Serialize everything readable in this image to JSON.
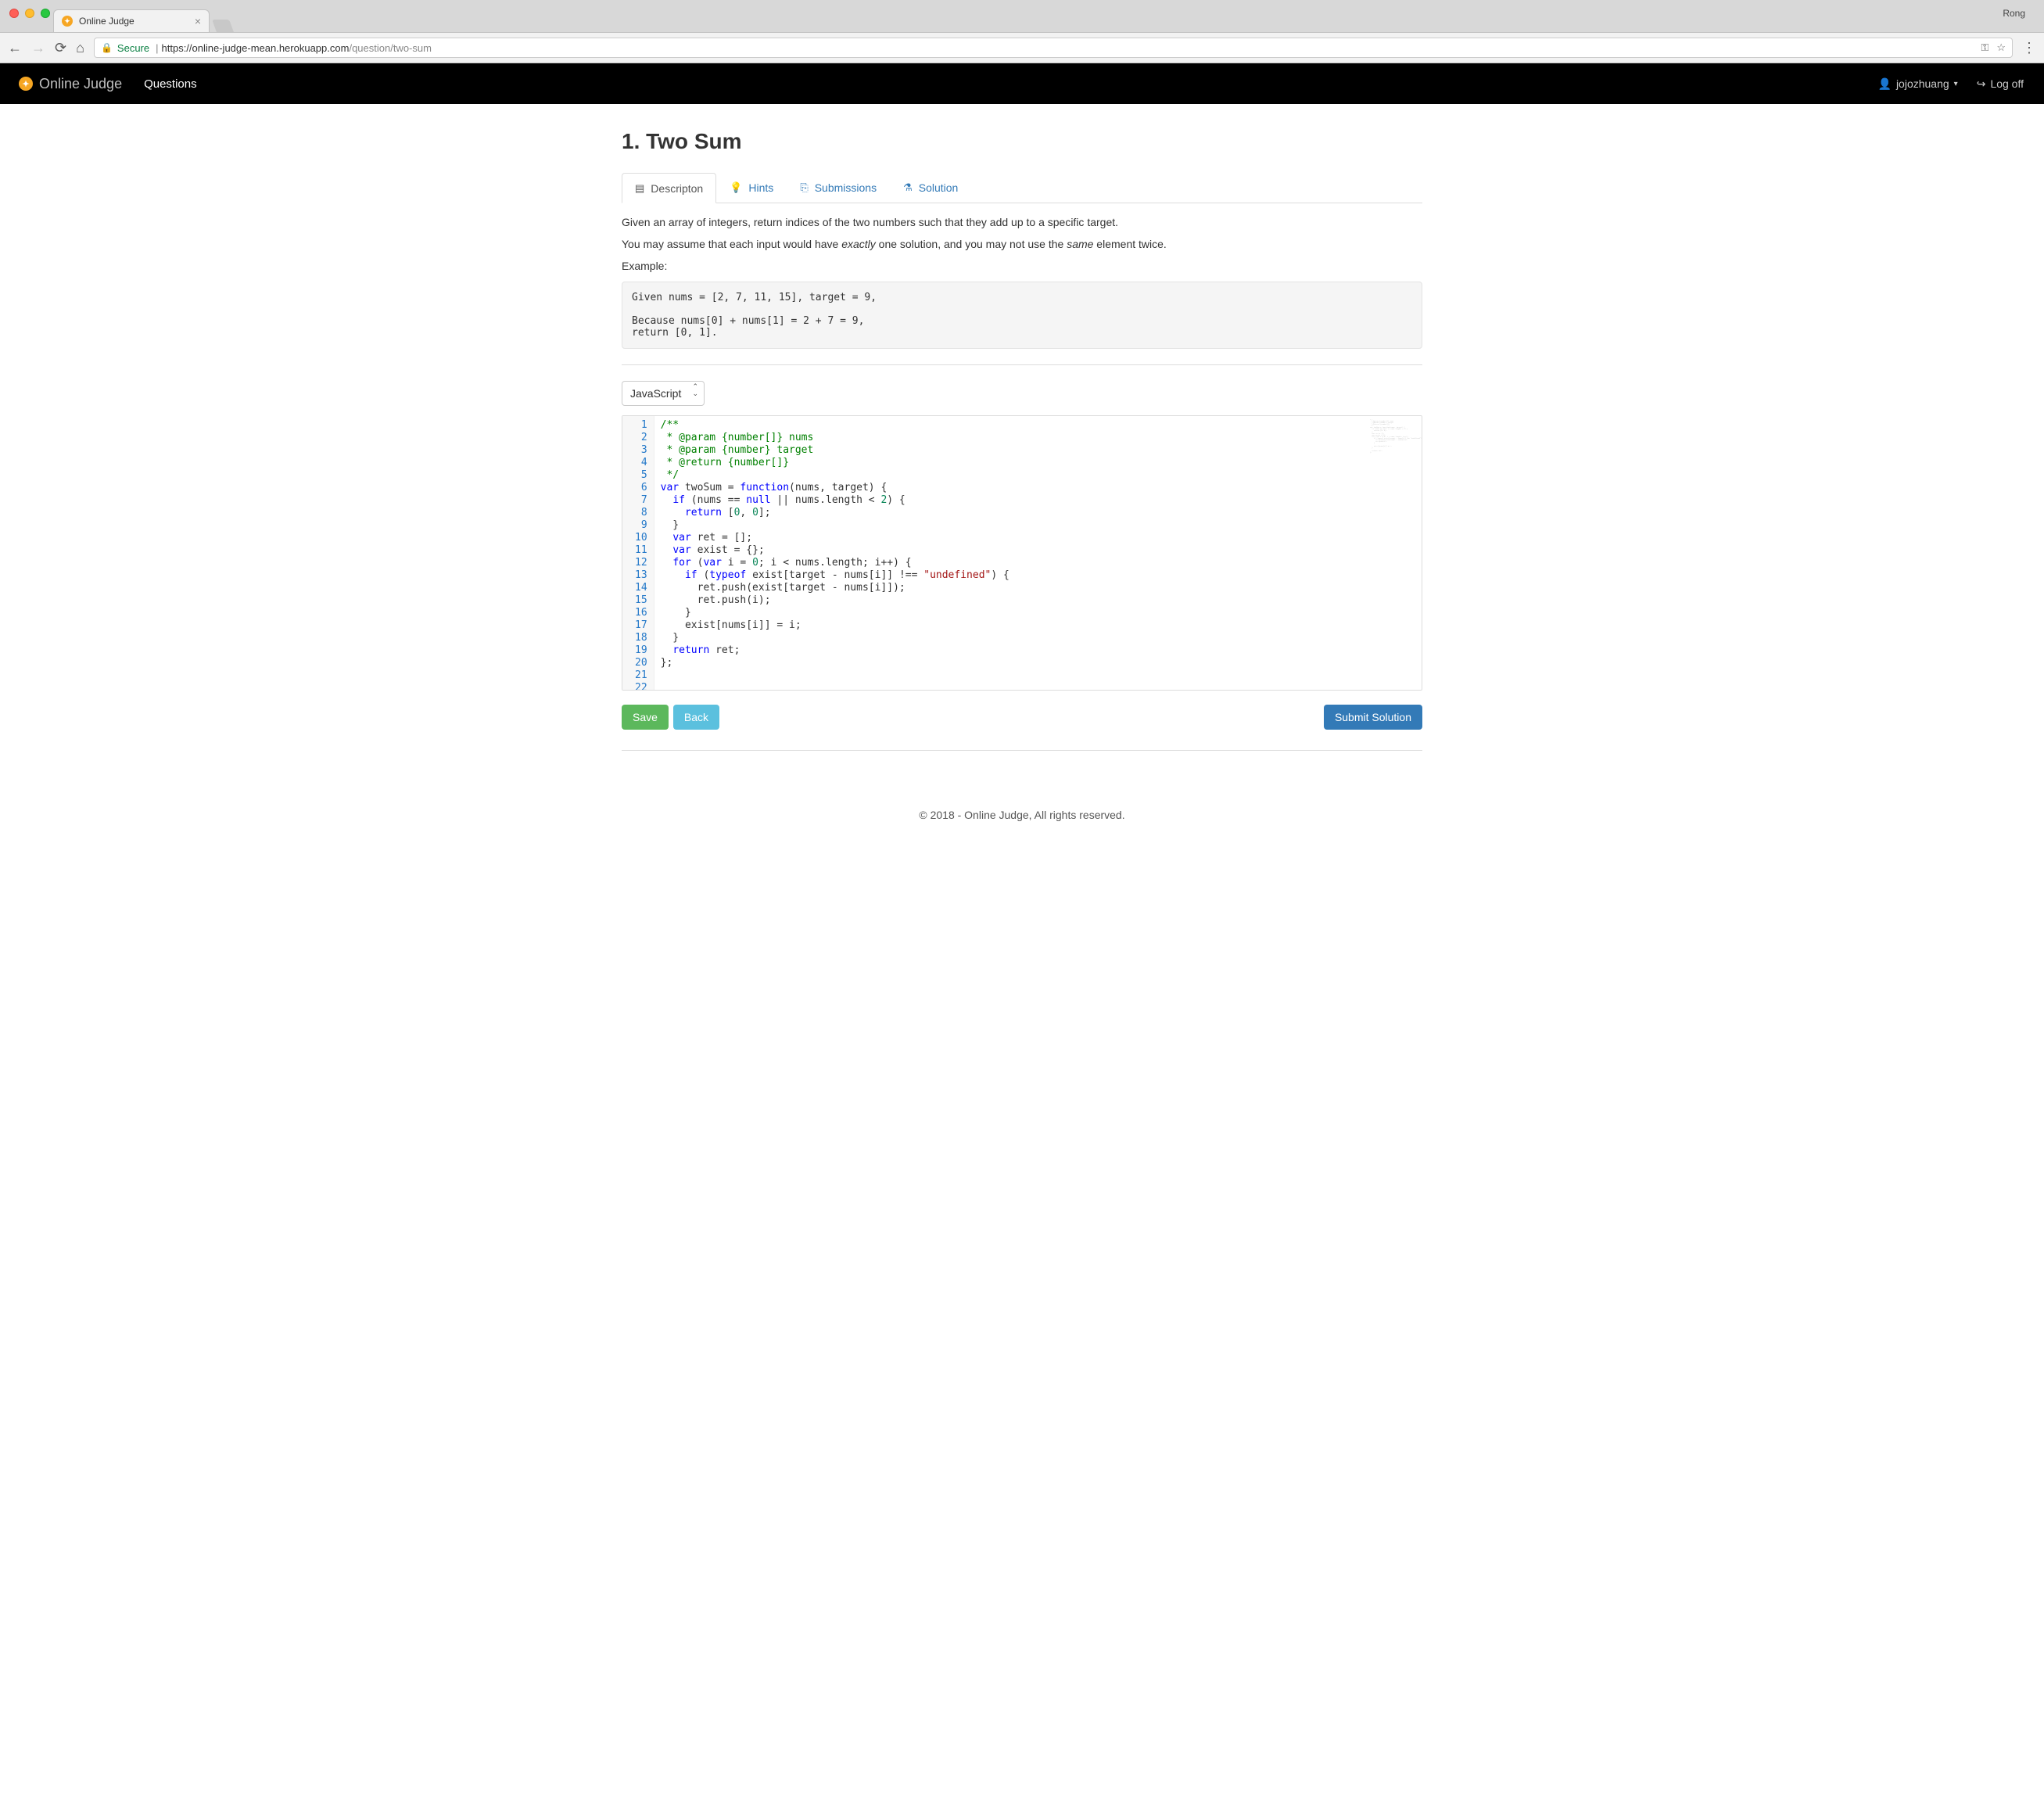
{
  "browser": {
    "tab_title": "Online Judge",
    "profile": "Rong",
    "secure_label": "Secure",
    "url_host": "https://online-judge-mean.herokuapp.com",
    "url_path": "/question/two-sum"
  },
  "navbar": {
    "brand": "Online Judge",
    "items": [
      "Questions"
    ],
    "user": "jojozhuang",
    "logoff": "Log off"
  },
  "page": {
    "title": "1. Two Sum",
    "tabs": [
      {
        "icon": "▤",
        "label": "Descripton"
      },
      {
        "icon": "💡",
        "label": "Hints"
      },
      {
        "icon": "⎘",
        "label": "Submissions"
      },
      {
        "icon": "⚗",
        "label": "Solution"
      }
    ],
    "desc": {
      "p1": "Given an array of integers, return indices of the two numbers such that they add up to a specific target.",
      "p2_pre": "You may assume that each input would have ",
      "p2_em1": "exactly",
      "p2_mid": " one solution, and you may not use the ",
      "p2_em2": "same",
      "p2_post": " element twice.",
      "example_label": "Example:",
      "example_code": "Given nums = [2, 7, 11, 15], target = 9,\n\nBecause nums[0] + nums[1] = 2 + 7 = 9,\nreturn [0, 1]."
    },
    "language": {
      "selected": "JavaScript",
      "options": [
        "JavaScript"
      ]
    },
    "code_lines": [
      [
        {
          "c": "tok-comment",
          "t": "/**"
        }
      ],
      [
        {
          "c": "tok-comment",
          "t": " * @param {number[]} nums"
        }
      ],
      [
        {
          "c": "tok-comment",
          "t": " * @param {number} target"
        }
      ],
      [
        {
          "c": "tok-comment",
          "t": " * @return {number[]}"
        }
      ],
      [
        {
          "c": "tok-comment",
          "t": " */"
        }
      ],
      [
        {
          "c": "tok-keyword",
          "t": "var"
        },
        {
          "c": "",
          "t": " twoSum "
        },
        {
          "c": "tok-op",
          "t": "="
        },
        {
          "c": "",
          "t": " "
        },
        {
          "c": "tok-keyword",
          "t": "function"
        },
        {
          "c": "",
          "t": "(nums, target) {"
        }
      ],
      [
        {
          "c": "",
          "t": "  "
        },
        {
          "c": "tok-keyword",
          "t": "if"
        },
        {
          "c": "",
          "t": " (nums "
        },
        {
          "c": "tok-op",
          "t": "=="
        },
        {
          "c": "",
          "t": " "
        },
        {
          "c": "tok-builtin",
          "t": "null"
        },
        {
          "c": "",
          "t": " "
        },
        {
          "c": "tok-op",
          "t": "||"
        },
        {
          "c": "",
          "t": " nums.length "
        },
        {
          "c": "tok-op",
          "t": "<"
        },
        {
          "c": "",
          "t": " "
        },
        {
          "c": "tok-num",
          "t": "2"
        },
        {
          "c": "",
          "t": ") {"
        }
      ],
      [
        {
          "c": "",
          "t": "    "
        },
        {
          "c": "tok-keyword",
          "t": "return"
        },
        {
          "c": "",
          "t": " ["
        },
        {
          "c": "tok-num",
          "t": "0"
        },
        {
          "c": "",
          "t": ", "
        },
        {
          "c": "tok-num",
          "t": "0"
        },
        {
          "c": "",
          "t": "];"
        }
      ],
      [
        {
          "c": "",
          "t": "  }"
        }
      ],
      [
        {
          "c": "",
          "t": "  "
        },
        {
          "c": "tok-keyword",
          "t": "var"
        },
        {
          "c": "",
          "t": " ret "
        },
        {
          "c": "tok-op",
          "t": "="
        },
        {
          "c": "",
          "t": " [];"
        }
      ],
      [
        {
          "c": "",
          "t": "  "
        },
        {
          "c": "tok-keyword",
          "t": "var"
        },
        {
          "c": "",
          "t": " exist "
        },
        {
          "c": "tok-op",
          "t": "="
        },
        {
          "c": "",
          "t": " {};"
        }
      ],
      [
        {
          "c": "",
          "t": "  "
        },
        {
          "c": "tok-keyword",
          "t": "for"
        },
        {
          "c": "",
          "t": " ("
        },
        {
          "c": "tok-keyword",
          "t": "var"
        },
        {
          "c": "",
          "t": " i "
        },
        {
          "c": "tok-op",
          "t": "="
        },
        {
          "c": "",
          "t": " "
        },
        {
          "c": "tok-num",
          "t": "0"
        },
        {
          "c": "",
          "t": "; i "
        },
        {
          "c": "tok-op",
          "t": "<"
        },
        {
          "c": "",
          "t": " nums.length; i"
        },
        {
          "c": "tok-op",
          "t": "++"
        },
        {
          "c": "",
          "t": ") {"
        }
      ],
      [
        {
          "c": "",
          "t": "    "
        },
        {
          "c": "tok-keyword",
          "t": "if"
        },
        {
          "c": "",
          "t": " ("
        },
        {
          "c": "tok-keyword",
          "t": "typeof"
        },
        {
          "c": "",
          "t": " exist[target "
        },
        {
          "c": "tok-op",
          "t": "-"
        },
        {
          "c": "",
          "t": " nums[i]] "
        },
        {
          "c": "tok-op",
          "t": "!=="
        },
        {
          "c": "",
          "t": " "
        },
        {
          "c": "tok-string",
          "t": "\"undefined\""
        },
        {
          "c": "",
          "t": ") {"
        }
      ],
      [
        {
          "c": "",
          "t": "      ret.push(exist[target "
        },
        {
          "c": "tok-op",
          "t": "-"
        },
        {
          "c": "",
          "t": " nums[i]]);"
        }
      ],
      [
        {
          "c": "",
          "t": "      ret.push(i);"
        }
      ],
      [
        {
          "c": "",
          "t": "    }"
        }
      ],
      [
        {
          "c": "",
          "t": ""
        }
      ],
      [
        {
          "c": "",
          "t": "    exist[nums[i]] "
        },
        {
          "c": "tok-op",
          "t": "="
        },
        {
          "c": "",
          "t": " i;"
        }
      ],
      [
        {
          "c": "",
          "t": "  }"
        }
      ],
      [
        {
          "c": "",
          "t": ""
        }
      ],
      [
        {
          "c": "",
          "t": "  "
        },
        {
          "c": "tok-keyword",
          "t": "return"
        },
        {
          "c": "",
          "t": " ret;"
        }
      ],
      [
        {
          "c": "",
          "t": "};"
        }
      ]
    ],
    "buttons": {
      "save": "Save",
      "back": "Back",
      "submit": "Submit Solution"
    }
  },
  "footer": "© 2018 - Online Judge, All rights reserved."
}
